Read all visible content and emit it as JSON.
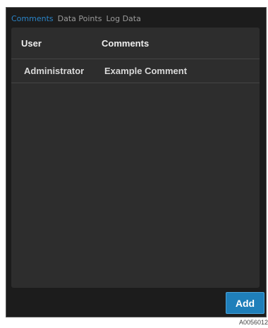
{
  "tabs": [
    {
      "label": "Comments",
      "active": true
    },
    {
      "label": "Data Points",
      "active": false
    },
    {
      "label": "Log Data",
      "active": false
    }
  ],
  "table": {
    "columns": [
      "User",
      "Comments"
    ],
    "rows": [
      {
        "user": "Administrator",
        "comment": "Example Comment"
      }
    ]
  },
  "actions": {
    "add_label": "Add"
  },
  "figure_code": "A0056012",
  "colors": {
    "accent": "#2a83c6",
    "button": "#1f7fba",
    "background": "#1c1c1c",
    "panel": "#2d2d2d"
  }
}
